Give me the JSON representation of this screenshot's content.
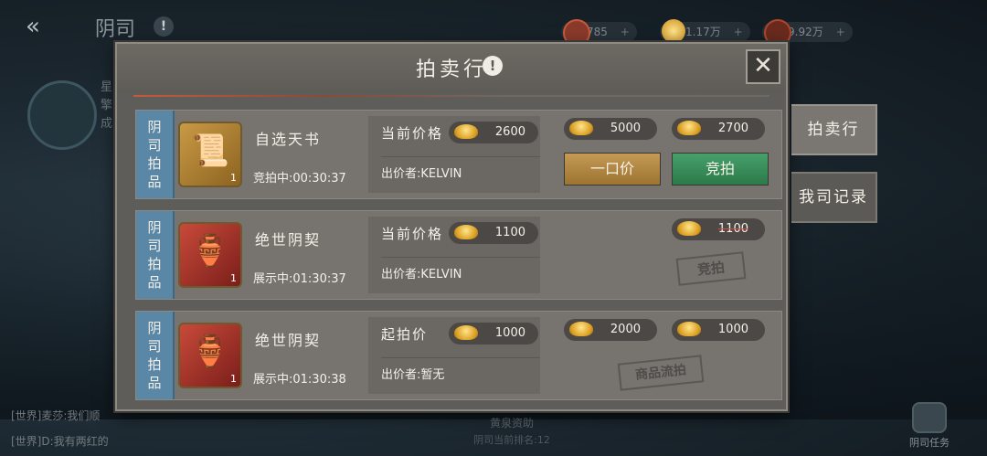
{
  "topbar": {
    "back_glyph": "«",
    "title": "阴司",
    "info_glyph": "!",
    "currencies": [
      {
        "icon": "spirit-coin-icon",
        "value": "785",
        "color": "#c85a3a"
      },
      {
        "icon": "gold-ingot-icon",
        "value": "1.17万",
        "color": "#d8a42a"
      },
      {
        "icon": "jade-coin-icon",
        "value": "9.92万",
        "color": "#b0452e"
      }
    ],
    "plus_glyph": "+"
  },
  "sidebar": {
    "text": "星 擎 成"
  },
  "chat": [
    {
      "text": "[世界]麦莎:我们顺"
    },
    {
      "text": "[世界]D:我有两红的"
    }
  ],
  "bottom": {
    "resource_label": "黄泉资助",
    "rank_label": "阴司当前排名:12",
    "task_label": "阴司任务"
  },
  "panel": {
    "title": "拍卖行",
    "info_glyph": "!",
    "close_glyph": "✕",
    "tag_text": [
      "阴",
      "司",
      "拍",
      "品"
    ],
    "items": [
      {
        "name": "自选天书",
        "count": "1",
        "glyph": "📜",
        "status_time": "竞拍中:00:30:37",
        "price_label": "当前价格",
        "price": "2600",
        "bidder": "出价者:KELVIN",
        "buyout_price": "5000",
        "next_bid": "2700",
        "buyout_label": "一口价",
        "bid_label": "竞拍"
      },
      {
        "name": "绝世阴契",
        "count": "1",
        "glyph": "🏺",
        "status_time": "展示中:01:30:37",
        "price_label": "当前价格",
        "price": "1100",
        "bidder": "出价者:KELVIN",
        "next_bid": "1100",
        "stamp": "竞拍"
      },
      {
        "name": "绝世阴契",
        "count": "1",
        "glyph": "🏺",
        "status_time": "展示中:01:30:38",
        "price_label": "起拍价",
        "price": "1000",
        "bidder": "出价者:暂无",
        "buyout_price": "2000",
        "next_bid": "1000",
        "stamp": "商品流拍"
      }
    ]
  },
  "tabs": {
    "auction": "拍卖行",
    "my_records": "我司记录"
  }
}
